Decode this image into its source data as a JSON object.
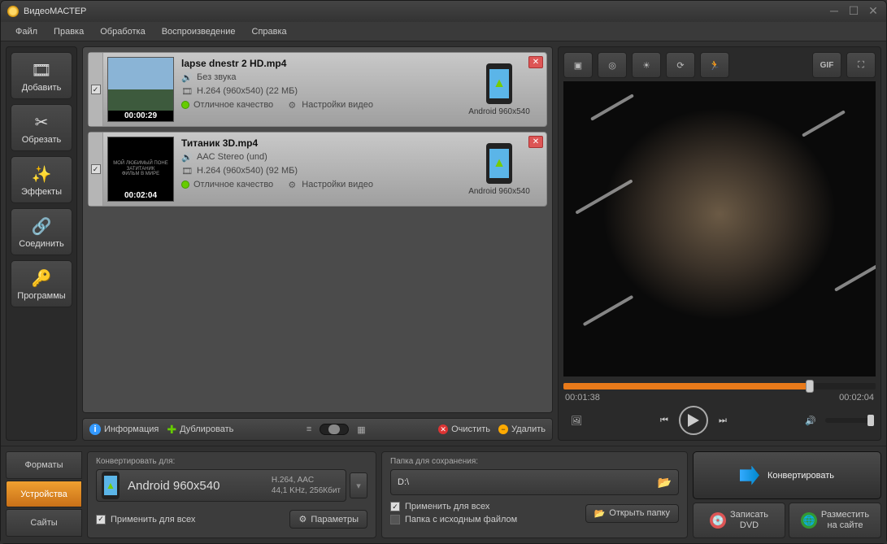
{
  "app": {
    "title": "ВидеоМАСТЕР"
  },
  "menu": [
    "Файл",
    "Правка",
    "Обработка",
    "Воспроизведение",
    "Справка"
  ],
  "sidebar": [
    {
      "label": "Добавить",
      "icon": "🎞"
    },
    {
      "label": "Обрезать",
      "icon": "✂"
    },
    {
      "label": "Эффекты",
      "icon": "✨"
    },
    {
      "label": "Соединить",
      "icon": "🔗"
    },
    {
      "label": "Программы",
      "icon": "🔑"
    }
  ],
  "files": [
    {
      "check": true,
      "title": "lapse dnestr 2 HD.mp4",
      "duration": "00:00:29",
      "audio": "Без звука",
      "video": "H.264 (960x540) (22 МБ)",
      "quality": "Отличное качество",
      "settings": "Настройки видео",
      "target": "Android 960x540",
      "thumb": "sky"
    },
    {
      "check": true,
      "title": "Титаник 3D.mp4",
      "duration": "00:02:04",
      "audio": "AAC Stereo (und)",
      "video": "H.264 (960x540) (92 МБ)",
      "quality": "Отличное качество",
      "settings": "Настройки видео",
      "target": "Android 960x540",
      "thumb": "dark",
      "thumbtext": "МОЙ ЛЮБИМЫЙ ПОНЕ ЗАТИТАНИК\nФИЛЬМ В МИРЕ"
    }
  ],
  "listfooter": {
    "info": "Информация",
    "duplicate": "Дублировать",
    "clear": "Очистить",
    "delete": "Удалить"
  },
  "preview": {
    "tools": [
      "crop-icon",
      "sun-icon",
      "brightness-icon",
      "speed-icon",
      "run-icon"
    ],
    "tools_right": [
      "GIF",
      "⛶"
    ],
    "currentTime": "00:01:38",
    "totalTime": "00:02:04",
    "progressPct": 79
  },
  "bottom": {
    "tabs": [
      "Форматы",
      "Устройства",
      "Сайты"
    ],
    "activeTab": 1,
    "convertFor": "Конвертировать для:",
    "formatName": "Android 960x540",
    "formatDetail1": "H.264, AAC",
    "formatDetail2": "44,1 KHz, 256Кбит",
    "applyAll": "Применить для всех",
    "params": "Параметры",
    "saveLabel": "Папка для сохранения:",
    "dest": "D:\\",
    "applyAll2": "Применить для всех",
    "sourceFolder": "Папка с исходным файлом",
    "openFolder": "Открыть папку",
    "convert": "Конвертировать",
    "burnDvd": "Записать\nDVD",
    "publish": "Разместить\nна сайте"
  }
}
